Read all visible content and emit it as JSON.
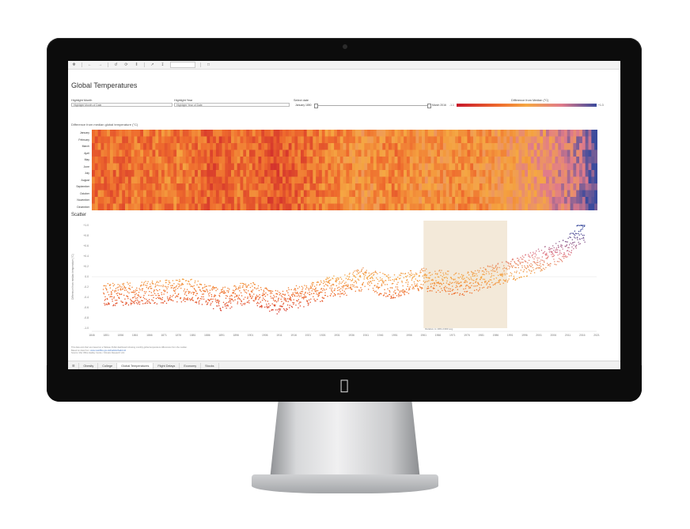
{
  "toolbar": {
    "icons": [
      "tableau-icon",
      "undo-icon",
      "redo-icon",
      "revert-icon",
      "refresh-icon",
      "pause-icon",
      "share-icon",
      "download-icon",
      "fullscreen-icon",
      "comment-icon"
    ]
  },
  "dashboard": {
    "title": "Global Temperatures"
  },
  "filters": {
    "highlight_month": {
      "label": "Highlight Month",
      "value": "Highlight Month of Date"
    },
    "highlight_year": {
      "label": "Highlight Year",
      "value": "Highlight Year of Date"
    },
    "select_date": {
      "label": "Select date",
      "start": "January 1850",
      "end": "March 2016"
    }
  },
  "legend": {
    "title": "Difference from Median (°C)",
    "min": "-1.1",
    "max": "+1.3"
  },
  "heatmap": {
    "title": "Difference from median global temperature (°C)",
    "months": [
      "January",
      "February",
      "March",
      "April",
      "May",
      "June",
      "July",
      "August",
      "September",
      "October",
      "November",
      "December"
    ]
  },
  "scatter": {
    "title": "Scatter",
    "ylabel": "Difference from median temperature (°C)",
    "annotation": "Relative to 1961-1990 avg"
  },
  "chart_data": {
    "type": "scatter",
    "title": "Scatter",
    "ylabel": "Difference from median temperature (°C)",
    "x_tick_labels": [
      "1846",
      "1851",
      "1856",
      "1861",
      "1866",
      "1871",
      "1876",
      "1881",
      "1886",
      "1891",
      "1896",
      "1901",
      "1906",
      "1911",
      "1916",
      "1921",
      "1926",
      "1931",
      "1936",
      "1941",
      "1946",
      "1951",
      "1956",
      "1961",
      "1966",
      "1971",
      "1976",
      "1981",
      "1986",
      "1991",
      "1996",
      "2001",
      "2006",
      "2011",
      "2016",
      "2021"
    ],
    "y_tick_labels": [
      "+1.0",
      "+0.8",
      "+0.6",
      "+0.4",
      "+0.2",
      "0.0",
      "-0.2",
      "-0.4",
      "-0.6",
      "-0.8",
      "-1.0"
    ],
    "ylim": [
      -1.0,
      1.0
    ],
    "highlight_band": {
      "from": 1961,
      "to": 1990
    },
    "trend": [
      {
        "year": 1850,
        "value": -0.35
      },
      {
        "year": 1870,
        "value": -0.3
      },
      {
        "year": 1880,
        "value": -0.25
      },
      {
        "year": 1890,
        "value": -0.45
      },
      {
        "year": 1900,
        "value": -0.3
      },
      {
        "year": 1910,
        "value": -0.5
      },
      {
        "year": 1920,
        "value": -0.35
      },
      {
        "year": 1940,
        "value": -0.05
      },
      {
        "year": 1950,
        "value": -0.2
      },
      {
        "year": 1960,
        "value": -0.05
      },
      {
        "year": 1975,
        "value": -0.15
      },
      {
        "year": 1990,
        "value": 0.1
      },
      {
        "year": 2000,
        "value": 0.3
      },
      {
        "year": 2010,
        "value": 0.5
      },
      {
        "year": 2016,
        "value": 0.9
      }
    ]
  },
  "footnote": {
    "line1": "This data and chart are based on a Tableau Public dashboard showing monthly global temperature differences from the median.",
    "line2": "Based on data from: ",
    "link": "www.metoffice.gov.uk/hadobs/hadcrut4",
    "line3": "Source: Met Office Hadley Centre / Climatic Research Unit"
  },
  "tabs": [
    {
      "label": "Obesity",
      "active": false
    },
    {
      "label": "College",
      "active": false
    },
    {
      "label": "Global Temperatures",
      "active": true
    },
    {
      "label": "Flight Delays",
      "active": false
    },
    {
      "label": "Economy",
      "active": false
    },
    {
      "label": "Stocks",
      "active": false
    }
  ],
  "colors": {
    "cold": "#c7172b",
    "mid": "#f5a742",
    "warm": "#3a4a9c",
    "highlight_band": "#f3e9d9"
  }
}
